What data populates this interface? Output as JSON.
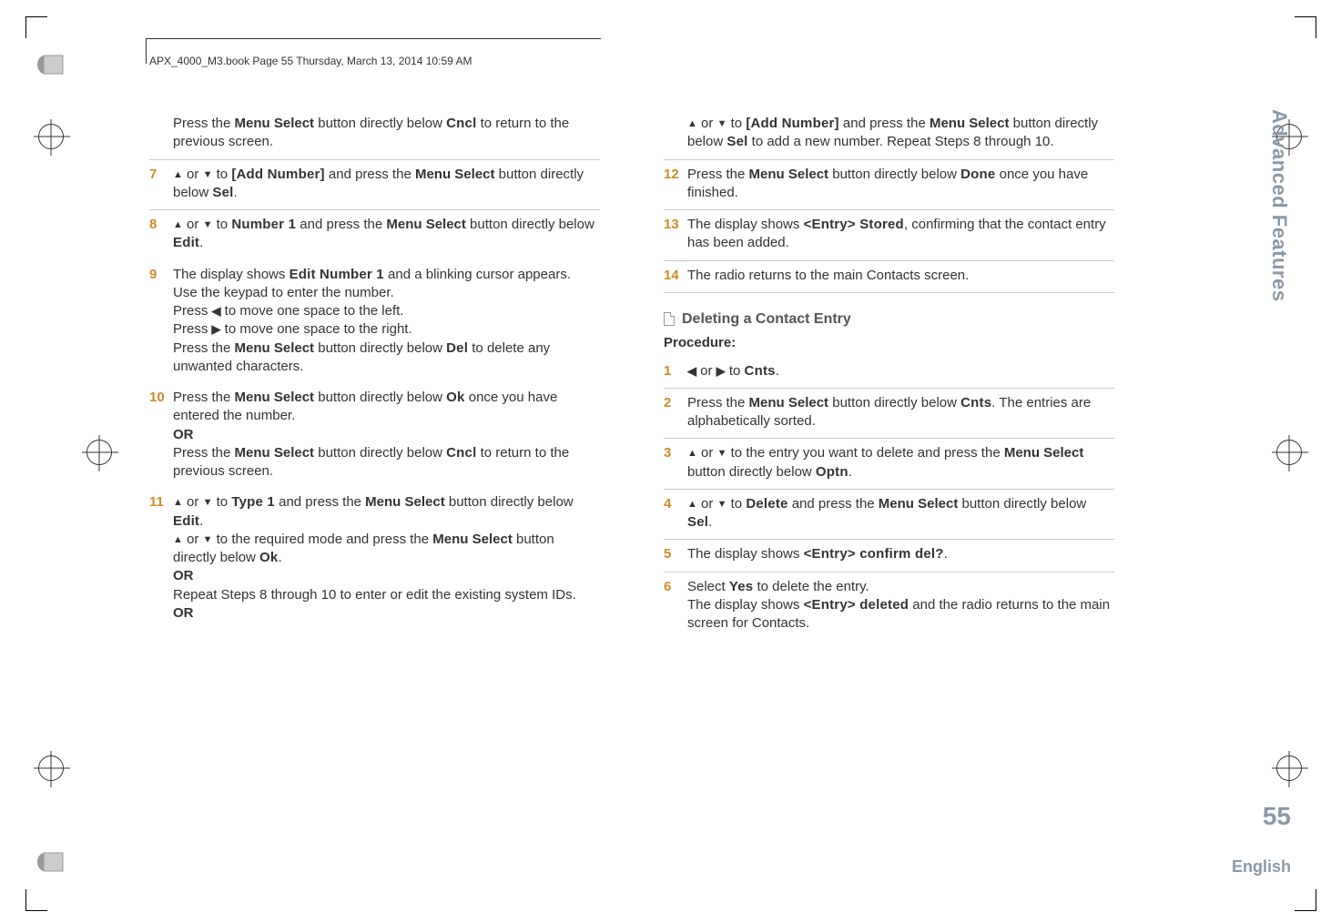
{
  "header": "APX_4000_M3.book  Page 55  Thursday, March 13, 2014  10:59 AM",
  "sideLabel": "Advanced Features",
  "pageNumber": "55",
  "language": "English",
  "left": {
    "pre": {
      "a": "Press the ",
      "b": "Menu Select",
      "c": " button directly below ",
      "d": "Cncl",
      "e": " to return to the previous screen."
    },
    "s7": {
      "num": "7",
      "a": " or ",
      "b": " to ",
      "c": "[Add Number]",
      "d": " and press the ",
      "e": "Menu Select",
      "f": " button directly below ",
      "g": "Sel",
      "h": "."
    },
    "s8": {
      "num": "8",
      "a": " or ",
      "b": " to ",
      "c": "Number 1",
      "d": " and press the ",
      "e": "Menu Select",
      "f": " button directly below ",
      "g": "Edit",
      "h": "."
    },
    "s9": {
      "num": "9",
      "a": "The display shows ",
      "b": "Edit Number 1",
      "c": " and a blinking cursor appears.",
      "d": "Use the keypad to enter the number.",
      "e": "Press ",
      "f": " to move one space to the left.",
      "g": "Press ",
      "h": " to move one space to the right.",
      "i": "Press the ",
      "j": "Menu Select",
      "k": " button directly below ",
      "l": "Del",
      "m": " to delete any unwanted characters."
    },
    "s10": {
      "num": "10",
      "a": "Press the ",
      "b": "Menu Select",
      "c": " button directly below ",
      "d": "Ok",
      "e": " once you have entered the number.",
      "or": "OR",
      "f": "Press the ",
      "g": "Menu Select",
      "h": " button directly below ",
      "i": "Cncl",
      "j": " to return to the previous screen."
    },
    "s11": {
      "num": "11",
      "a": " or ",
      "b": " to ",
      "c": "Type 1",
      "d": " and press the ",
      "e": "Menu Select",
      "f": " button directly below ",
      "g": "Edit",
      "h": ".",
      "i": " or ",
      "j": " to the required mode and press the ",
      "k": "Menu Select",
      "l": " button directly below ",
      "m": "Ok",
      "n": ".",
      "or1": "OR",
      "o": "Repeat Steps 8 through 10 to enter or edit the existing system IDs.",
      "or2": "OR"
    }
  },
  "right": {
    "cont": {
      "a": " or ",
      "b": " to ",
      "c": "[Add Number]",
      "d": " and press the ",
      "e": "Menu Select",
      "f": " button directly below ",
      "g": "Sel",
      "h": " to add a new number. Repeat Steps 8 through 10."
    },
    "s12": {
      "num": "12",
      "a": "Press the ",
      "b": "Menu Select",
      "c": " button directly below ",
      "d": "Done",
      "e": " once you have finished."
    },
    "s13": {
      "num": "13",
      "a": "The display shows ",
      "b": "<Entry> Stored",
      "c": ", confirming that the contact entry has been added."
    },
    "s14": {
      "num": "14",
      "a": "The radio returns to the main Contacts screen."
    },
    "section": "Deleting a Contact Entry",
    "procLabel": "Procedure:",
    "d1": {
      "num": "1",
      "a": " or ",
      "b": " to ",
      "c": "Cnts",
      "d": "."
    },
    "d2": {
      "num": "2",
      "a": "Press the ",
      "b": "Menu Select",
      "c": " button directly below ",
      "d": "Cnts",
      "e": ". The entries are alphabetically sorted."
    },
    "d3": {
      "num": "3",
      "a": " or ",
      "b": " to the entry you want to delete and press the ",
      "c": "Menu Select",
      "d": " button directly below ",
      "e": "Optn",
      "f": "."
    },
    "d4": {
      "num": "4",
      "a": " or ",
      "b": " to ",
      "c": "Delete",
      "d": " and press the ",
      "e": "Menu Select",
      "f": " button directly below ",
      "g": "Sel",
      "h": "."
    },
    "d5": {
      "num": "5",
      "a": "The display shows ",
      "b": "<Entry> confirm del?",
      "c": "."
    },
    "d6": {
      "num": "6",
      "a": "Select ",
      "b": "Yes",
      "c": " to delete the entry.",
      "d": "The display shows ",
      "e": "<Entry> deleted",
      "f": " and the radio returns to the main screen for Contacts."
    }
  }
}
